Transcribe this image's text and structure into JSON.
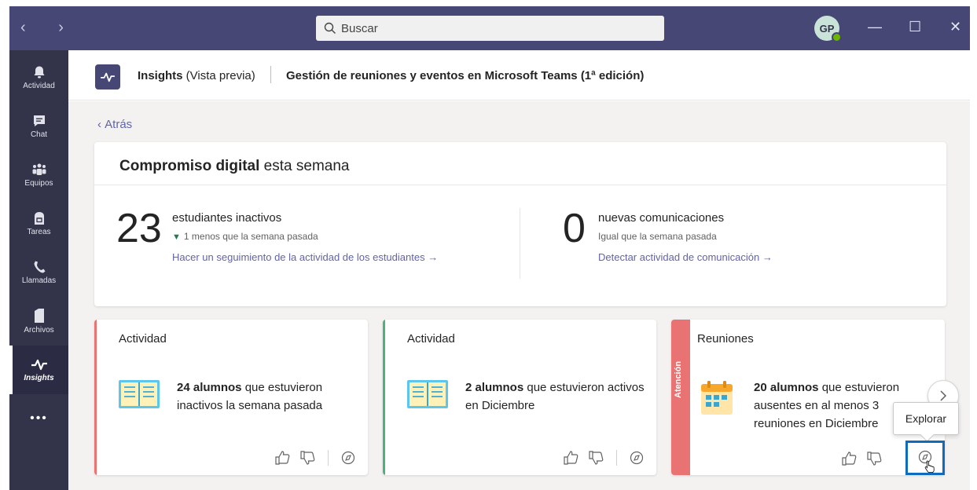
{
  "titlebar": {
    "nav_arrows": "‹ ›",
    "search_placeholder": "Buscar",
    "avatar_initials": "GP",
    "min": "—",
    "max": "☐",
    "close": "✕"
  },
  "rail": {
    "items": [
      {
        "label": "Actividad",
        "icon": "bell-icon"
      },
      {
        "label": "Chat",
        "icon": "chat-icon"
      },
      {
        "label": "Equipos",
        "icon": "teams-icon"
      },
      {
        "label": "Tareas",
        "icon": "assignments-icon"
      },
      {
        "label": "Llamadas",
        "icon": "phone-icon"
      },
      {
        "label": "Archivos",
        "icon": "files-icon"
      },
      {
        "label": "Insights",
        "icon": "pulse-icon",
        "active": true
      }
    ],
    "more": "•••"
  },
  "header": {
    "app_name": "Insights",
    "app_suffix": " (Vista previa)",
    "course": "Gestión de reuniones y eventos en Microsoft Teams (1ª edición)"
  },
  "back_label": "Atrás",
  "summary": {
    "title_bold": "Compromiso digital",
    "title_rest": " esta semana",
    "left": {
      "number": "23",
      "heading": "estudiantes inactivos",
      "change_indicator": "▼",
      "change": "1 menos que la semana pasada",
      "link": "Hacer un seguimiento de la actividad de los estudiantes →"
    },
    "right": {
      "number": "0",
      "heading": "nuevas comunicaciones",
      "change": "Igual que la semana pasada",
      "link": "Detectar actividad de comunicación →"
    }
  },
  "cards": [
    {
      "title": "Actividad",
      "bold": "24 alumnos",
      "text": " que estuvieron inactivos la semana pasada",
      "accent": "#e97373",
      "icon": "book-icon"
    },
    {
      "title": "Actividad",
      "bold": "2 alumnos",
      "text": " que estuvieron activos en Diciembre",
      "accent": "#4bb37a",
      "icon": "book-icon"
    },
    {
      "title": "Reuniones",
      "bold": "20 alumnos",
      "text": " que estuvieron ausentes en al menos 3 reuniones en Diciembre",
      "accent": "#e97373",
      "icon": "calendar-icon",
      "badge": "Atención"
    }
  ],
  "tooltip": "Explorar",
  "colors": {
    "titlebar": "#464775",
    "rail": "#33344a",
    "link": "#6264a7",
    "highlight": "#0f6cbd"
  }
}
